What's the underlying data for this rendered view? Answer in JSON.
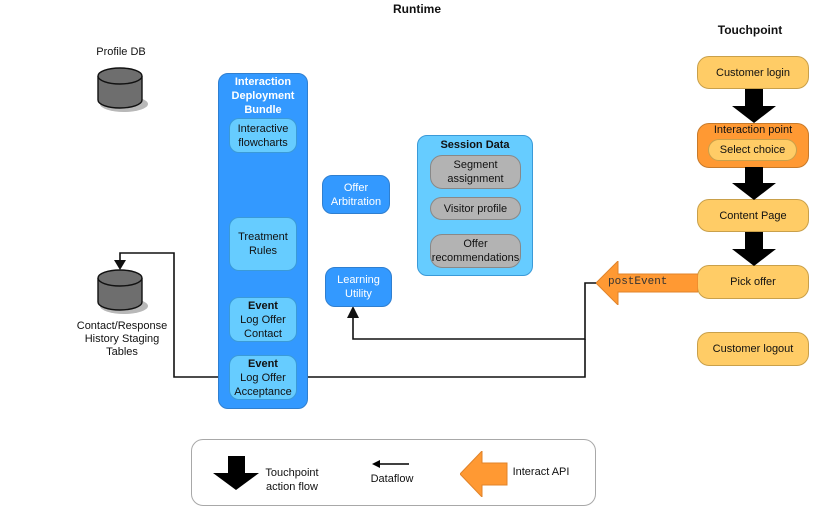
{
  "profile_db": {
    "label": "Profile DB"
  },
  "history_db": {
    "label_lines": [
      "Contact/Response",
      "History Staging",
      "Tables"
    ]
  },
  "runtime": {
    "title": "Runtime",
    "bundle": {
      "title_lines": [
        "Interaction",
        "Deployment",
        "Bundle"
      ],
      "items": [
        {
          "lines": [
            "Interactive",
            "flowcharts"
          ]
        },
        {
          "lines": [
            "Treatment",
            "Rules"
          ]
        },
        {
          "bold": "Event",
          "lines": [
            "Log Offer",
            "Contact"
          ]
        },
        {
          "bold": "Event",
          "lines": [
            "Log Offer",
            "Acceptance"
          ]
        }
      ]
    },
    "offer_arbitration": {
      "lines": [
        "Offer",
        "Arbitration"
      ]
    },
    "learning_utility": {
      "lines": [
        "Learning",
        "Utility"
      ]
    },
    "session_data": {
      "title": "Session Data",
      "items": [
        {
          "lines": [
            "Segment",
            "assignment"
          ]
        },
        {
          "lines": [
            "Visitor profile"
          ]
        },
        {
          "lines": [
            "Offer",
            "recommendations"
          ]
        }
      ]
    }
  },
  "api_call": {
    "label": "postEvent"
  },
  "touchpoint": {
    "title": "Touchpoint",
    "steps": {
      "login": "Customer login",
      "interaction_point": "Interaction point",
      "select_choice": "Select choice",
      "content_page": "Content Page",
      "pick_offer": "Pick offer",
      "logout": "Customer logout"
    }
  },
  "legend": {
    "touchpoint_flow_lines": [
      "Touchpoint",
      "action flow"
    ],
    "dataflow": "Dataflow",
    "interact_api": "Interact API"
  },
  "colors": {
    "panel_bg": "#e6e6e6",
    "bundle_blue": "#3399ff",
    "light_blue": "#66ccff",
    "gray_item": "#b3b3b3",
    "touchpoint_orange_light": "#ffcc66",
    "touchpoint_orange_dark": "#ff9933",
    "api_arrow": "#ff9933"
  }
}
